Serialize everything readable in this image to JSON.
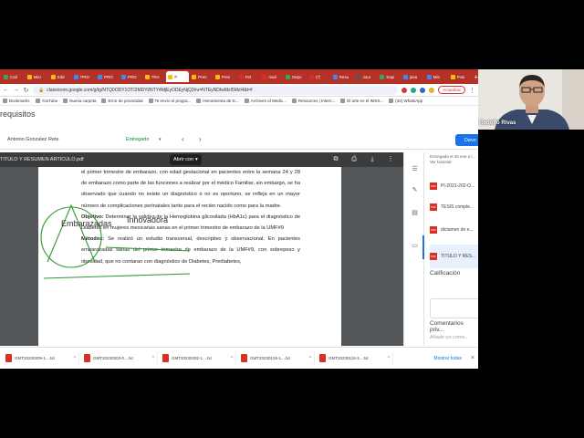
{
  "browser": {
    "tabs": [
      {
        "label": "Call",
        "color": "#34a853"
      },
      {
        "label": "Micr",
        "color": "#fbbc05"
      },
      {
        "label": "Edic",
        "color": "#fbbc05"
      },
      {
        "label": "PRO",
        "color": "#4285f4"
      },
      {
        "label": "PRO",
        "color": "#4285f4"
      },
      {
        "label": "PRO",
        "color": "#4285f4"
      },
      {
        "label": "TRA",
        "color": "#fbbc05"
      },
      {
        "label": "P",
        "color": "#fbbc05",
        "active": true
      },
      {
        "label": "Pren",
        "color": "#fbbc05"
      },
      {
        "label": "Pren",
        "color": "#fbbc05"
      },
      {
        "label": "Fet",
        "color": "#d93025"
      },
      {
        "label": "mail",
        "color": "#d93025"
      },
      {
        "label": "Depc",
        "color": "#34a853"
      },
      {
        "label": "(7)",
        "color": "#d93025"
      },
      {
        "label": "Resu",
        "color": "#4285f4"
      },
      {
        "label": "Jour",
        "color": "#555555"
      },
      {
        "label": "Sapi",
        "color": "#34a853"
      },
      {
        "label": "java",
        "color": "#4285f4"
      },
      {
        "label": "Mis",
        "color": "#4285f4"
      },
      {
        "label": "Posi",
        "color": "#fbbc05"
      }
    ],
    "url": "classroom.google.com/g/tg/NTQ0ODY1OTI2MDYl/NTY4MjEyODEyNjQ3#u=NTEyNDIwMzI5MzI4&t=f",
    "update_label": "Actualizar",
    "bookmarks": [
      "Bookmarks",
      "YouTube",
      "Nueva carpeta",
      "Error de privacidad",
      "Te envío el progra...",
      "Herramienta de D...",
      "Archives of Medic...",
      "Resources | Intern...",
      "El arte en el IMSS...",
      "(34) WhatsApp"
    ]
  },
  "classroom": {
    "page_title": "requisitos",
    "student_name": "Antonio Gonzalez Rete",
    "student_status": "Entregado",
    "return_label": "Devo"
  },
  "viewer": {
    "file_title": "TITULO Y RESUMEN ARTICULO.pdf",
    "open_with_label": "Abrir con",
    "paragraph1": "el primer trimestre de embarazo, con edad gestacional en pacientes entre la semana 24 y 28 de embarazo como parte de las funciones a realizar por el médico Familiar, sin embargo, se ha observado que cuando no existe un diagnóstico o no es oportuno, se refleja en un mayor número de complicaciones perinatales tanto para el recién nacido como para la madre.",
    "objective_label": "Objetivo:",
    "objective_text": " Determinar la validez de la Hemoglobina glicosilada (HbA1c) para el diagnóstico de Diabetes en mujeres mexicanas sanas en el primer trimestre de embarazo de la UMF#9",
    "methods_label": "Métodos:",
    "methods_text": " Se realizó un estudio transversal, descriptivo y observacional. En pacientes embarazadas sanas del primer trimestre de embarazo de la UMF#9, con sobrepeso y obesidad, que no contaran con diagnóstico de Diabetes, Prediabetes,",
    "annotation_1": "Embarazadas",
    "annotation_2": "Innovadora",
    "annotation_color": "#2e9b2e"
  },
  "side_panel": {
    "submitted_info": "Entregada el 26 ene a l...",
    "history_link": "Ver historial",
    "attachments": [
      "PI-2021-202-O...",
      "TESIS comple...",
      "dictamen de e...",
      "TITULO Y RES..."
    ],
    "grade_title": "Calificación",
    "comments_title": "Comentarios priv...",
    "comment_placeholder": "Añade un come..."
  },
  "downloads": {
    "items": [
      "GMT20230209-1....txt",
      "GMT20230203-0....txt",
      "GMT20230202-1....txt",
      "GMT20230126-1....txt",
      "GMT20230119-3....txt"
    ],
    "show_all_label": "Mostrar todas"
  },
  "webcam": {
    "participant_name": "Rodolfo Rivas"
  }
}
